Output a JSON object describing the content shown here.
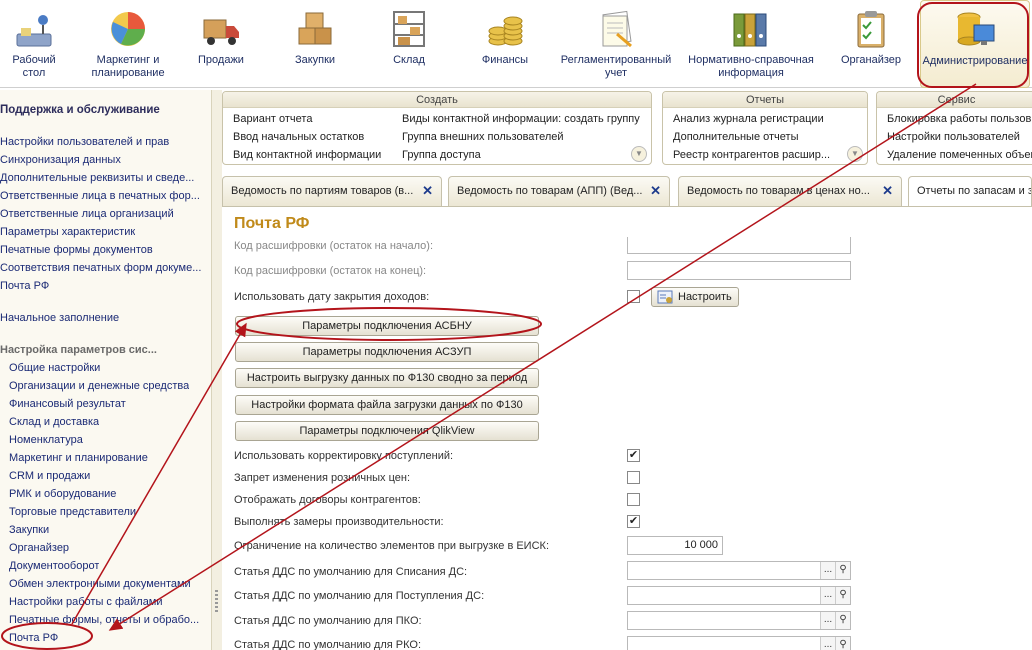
{
  "sections": [
    {
      "id": "desktop",
      "label": "Рабочий стол",
      "icon": "desktop-icon"
    },
    {
      "id": "marketing",
      "label": "Маркетинг и планирование",
      "icon": "pie-chart-icon"
    },
    {
      "id": "sales",
      "label": "Продажи",
      "icon": "truck-icon"
    },
    {
      "id": "purchases",
      "label": "Закупки",
      "icon": "boxes-icon"
    },
    {
      "id": "warehouse",
      "label": "Склад",
      "icon": "shelf-icon"
    },
    {
      "id": "finance",
      "label": "Финансы",
      "icon": "coins-icon"
    },
    {
      "id": "reg-accounting",
      "label": "Регламентированный учет",
      "icon": "documents-icon"
    },
    {
      "id": "reference",
      "label": "Нормативно-справочная информация",
      "icon": "binders-icon"
    },
    {
      "id": "organizer",
      "label": "Органайзер",
      "icon": "clipboard-icon"
    },
    {
      "id": "admin",
      "label": "Администрирование",
      "icon": "database-monitor-icon"
    }
  ],
  "left": {
    "heading1": "Поддержка и обслуживание",
    "items1": [
      "Настройки пользователей и прав",
      "Синхронизация данных",
      "Дополнительные реквизиты и сведе...",
      "Ответственные лица в печатных фор...",
      "Ответственные лица организаций",
      "Параметры характеристик",
      "Печатные формы документов",
      "Соответствия печатных форм докуме...",
      "Почта РФ"
    ],
    "initial": "Начальное заполнение",
    "heading2": "Настройка параметров сис...",
    "items2": [
      "Общие настройки",
      "Организации и денежные средства",
      "Финансовый результат",
      "Склад и доставка",
      "Номенклатура",
      "Маркетинг и планирование",
      "CRM и продажи",
      "РМК и оборудование",
      "Торговые представители",
      "Закупки",
      "Органайзер",
      "Документооборот",
      "Обмен электронными документами",
      "Настройки работы с файлами",
      "Печатные формы, отчеты и обрабо...",
      "Почта РФ"
    ]
  },
  "panels": {
    "create": {
      "title": "Создать",
      "col1": [
        "Вариант отчета",
        "Ввод начальных остатков",
        "Вид контактной информации"
      ],
      "col2": [
        "Виды контактной информации: создать группу",
        "Группа внешних пользователей",
        "Группа доступа"
      ]
    },
    "reports": {
      "title": "Отчеты",
      "items": [
        "Анализ журнала регистрации",
        "Дополнительные отчеты",
        "Реестр контрагентов расшир..."
      ]
    },
    "service": {
      "title": "Сервис",
      "items": [
        "Блокировка работы пользов",
        "Настройки пользователей",
        "Удаление помеченных объект"
      ]
    }
  },
  "tabs": [
    {
      "label": "Ведомость по партиям товаров (в..."
    },
    {
      "label": "Ведомость по товарам (АПП) (Вед..."
    },
    {
      "label": "Ведомость по товарам в ценах но..."
    },
    {
      "label": "Отчеты по запасам и за"
    }
  ],
  "form": {
    "title": "Почта РФ",
    "decode_start_label": "Код расшифровки (остаток на начало):",
    "decode_end_label": "Код расшифровки (остаток на конец):",
    "use_close_date_label": "Использовать дату закрытия доходов:",
    "configure_label": "Настроить",
    "buttons": [
      "Параметры подключения АСБНУ",
      "Параметры подключения АСЗУП",
      "Настроить выгрузку данных по Ф130 сводно за период",
      "Настройки формата файла загрузки данных по Ф130",
      "Параметры подключения QlikView"
    ],
    "checks": [
      {
        "label": "Использовать корректировку поступлений:",
        "checked": true
      },
      {
        "label": "Запрет изменения розничных цен:",
        "checked": false
      },
      {
        "label": "Отображать договоры контрагентов:",
        "checked": false
      },
      {
        "label": "Выполнять замеры производительности:",
        "checked": true
      }
    ],
    "limit_label": "Ограничение на количество элементов при выгрузке в ЕИСК:",
    "limit_value": "10 000",
    "dds": [
      "Статья ДДС по умолчанию для Списания ДС:",
      "Статья ДДС по умолчанию для Поступления ДС:",
      "Статья ДДС по умолчанию для ПКО:",
      "Статья ДДС по умолчанию для РКО:"
    ],
    "ellipsis": "...",
    "checkmark": "✔"
  },
  "colors": {
    "annotation": "#b3141b",
    "link": "#1b2a75",
    "title": "#c08a1a"
  }
}
